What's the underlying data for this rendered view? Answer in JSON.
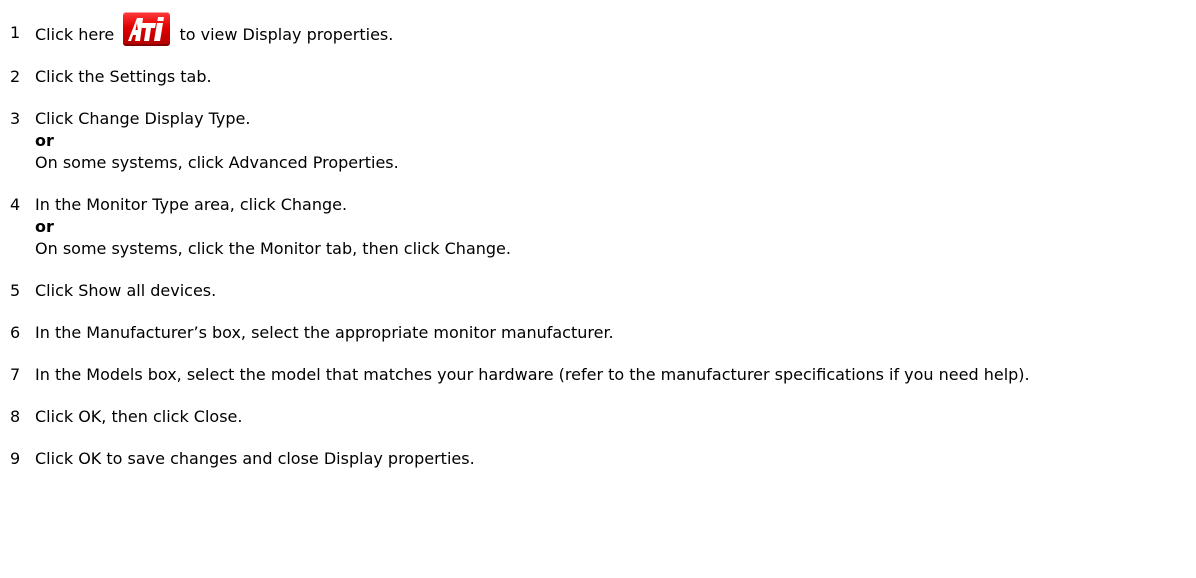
{
  "steps": [
    {
      "num": "1",
      "before_icon": "Click here",
      "icon": "ati-logo-icon",
      "after_icon": "to view Display properties."
    },
    {
      "num": "2",
      "text": "Click the Settings tab."
    },
    {
      "num": "3",
      "text": "Click Change Display Type.",
      "or": "or",
      "alt": "On some systems, click Advanced Properties."
    },
    {
      "num": "4",
      "text": "In the Monitor Type area, click Change.",
      "or": "or",
      "alt": "On some systems, click the Monitor tab, then click Change."
    },
    {
      "num": "5",
      "text": "Click Show all devices."
    },
    {
      "num": "6",
      "text": "In the Manufacturer’s box, select the appropriate monitor manufacturer."
    },
    {
      "num": "7",
      "text": "In the Models box, select the model that matches your hardware (refer to the manufacturer specifications if you need help)."
    },
    {
      "num": "8",
      "text": "Click OK, then click Close."
    },
    {
      "num": "9",
      "text": "Click OK to save changes and close Display properties."
    }
  ],
  "colors": {
    "ati_red": "#e10000",
    "ati_letters": "#ffffff"
  }
}
